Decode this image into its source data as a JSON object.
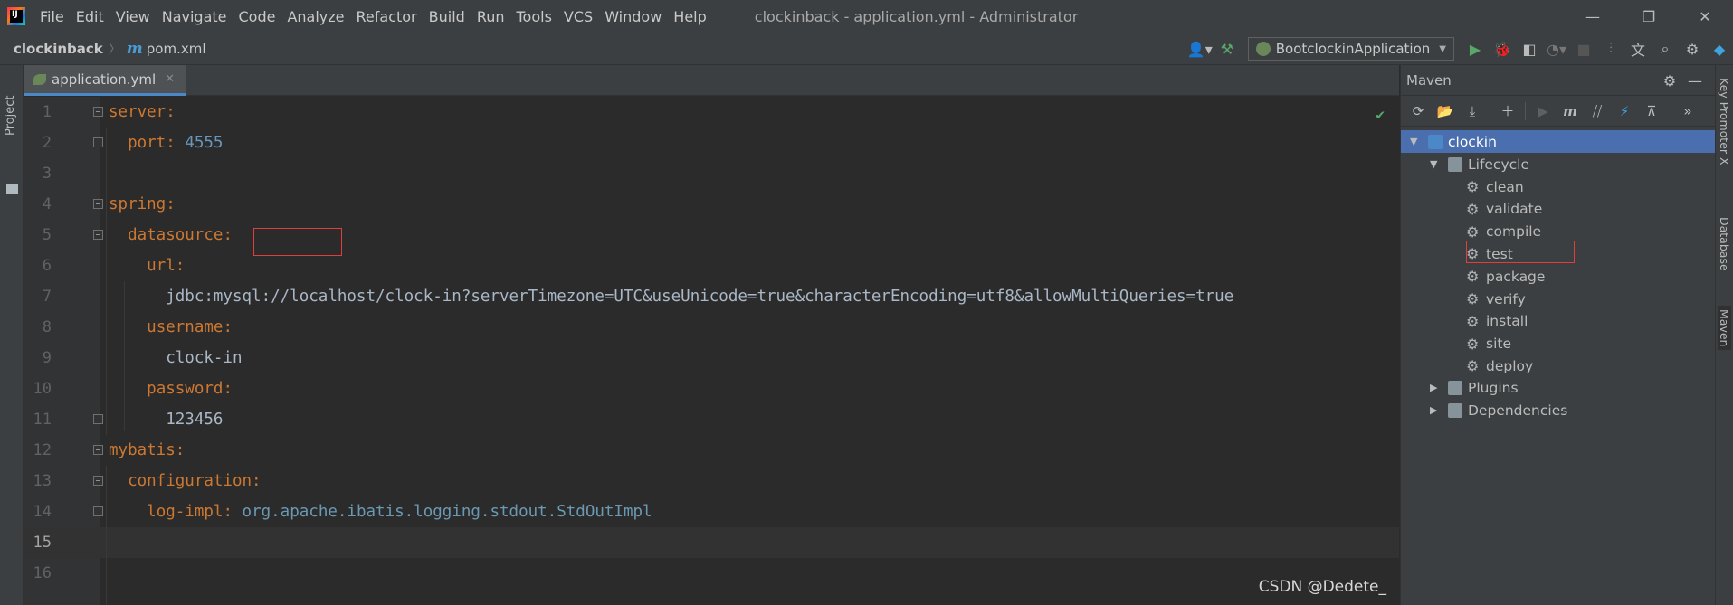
{
  "titlebar": {
    "menu": [
      "File",
      "Edit",
      "View",
      "Navigate",
      "Code",
      "Analyze",
      "Refactor",
      "Build",
      "Run",
      "Tools",
      "VCS",
      "Window",
      "Help"
    ],
    "window_title": "clockinback - application.yml - Administrator",
    "minimize_glyph": "—",
    "restore_glyph": "❐",
    "close_glyph": "✕"
  },
  "navbar": {
    "project": "clockinback",
    "file": "pom.xml",
    "run_config": "BootclockinApplication"
  },
  "left_strip": {
    "project_tab": "Project"
  },
  "editor": {
    "tab_label": "application.yml",
    "lines": [
      {
        "num": "1",
        "indent": "",
        "key": "server",
        "sep": ":",
        "value": "",
        "value_kind": ""
      },
      {
        "num": "2",
        "indent": "  ",
        "key": "port",
        "sep": ": ",
        "value": "4555",
        "value_kind": "num"
      },
      {
        "num": "3",
        "indent": "",
        "key": "",
        "sep": "",
        "value": "",
        "value_kind": ""
      },
      {
        "num": "4",
        "indent": "",
        "key": "spring",
        "sep": ":",
        "value": "",
        "value_kind": ""
      },
      {
        "num": "5",
        "indent": "  ",
        "key": "datasource",
        "sep": ":",
        "value": "",
        "value_kind": ""
      },
      {
        "num": "6",
        "indent": "    ",
        "key": "url",
        "sep": ":",
        "value": "",
        "value_kind": ""
      },
      {
        "num": "7",
        "indent": "      ",
        "key": "",
        "sep": "",
        "value": "jdbc:mysql://localhost/clock-in?serverTimezone=UTC&useUnicode=true&characterEncoding=utf8&allowMultiQueries=true",
        "value_kind": "str"
      },
      {
        "num": "8",
        "indent": "    ",
        "key": "username",
        "sep": ":",
        "value": "",
        "value_kind": ""
      },
      {
        "num": "9",
        "indent": "      ",
        "key": "",
        "sep": "",
        "value": "clock-in",
        "value_kind": "str"
      },
      {
        "num": "10",
        "indent": "    ",
        "key": "password",
        "sep": ":",
        "value": "",
        "value_kind": ""
      },
      {
        "num": "11",
        "indent": "      ",
        "key": "",
        "sep": "",
        "value": "123456",
        "value_kind": "str"
      },
      {
        "num": "12",
        "indent": "",
        "key": "mybatis",
        "sep": ":",
        "value": "",
        "value_kind": ""
      },
      {
        "num": "13",
        "indent": "  ",
        "key": "configuration",
        "sep": ":",
        "value": "",
        "value_kind": ""
      },
      {
        "num": "14",
        "indent": "    ",
        "key": "log-impl",
        "sep": ": ",
        "value": "org.apache.ibatis.logging.stdout.StdOutImpl",
        "value_kind": "pkg"
      },
      {
        "num": "15",
        "indent": "",
        "key": "",
        "sep": "",
        "value": "",
        "value_kind": ""
      },
      {
        "num": "16",
        "indent": "",
        "key": "",
        "sep": "",
        "value": "",
        "value_kind": ""
      }
    ],
    "current_line": "15",
    "watermark": "CSDN @Dedete_"
  },
  "maven": {
    "title": "Maven",
    "tree": {
      "project": "clockin",
      "lifecycle": "Lifecycle",
      "phases": [
        "clean",
        "validate",
        "compile",
        "test",
        "package",
        "verify",
        "install",
        "site",
        "deploy"
      ],
      "plugins": "Plugins",
      "dependencies": "Dependencies"
    }
  },
  "right_strip": {
    "tabs": [
      "Key Promoter X",
      "Database",
      "Maven"
    ]
  },
  "colors": {
    "keyword": "#cc7832",
    "number": "#6897bb",
    "selection": "#4b6eaf",
    "annotation_box": "#e23d3d"
  }
}
